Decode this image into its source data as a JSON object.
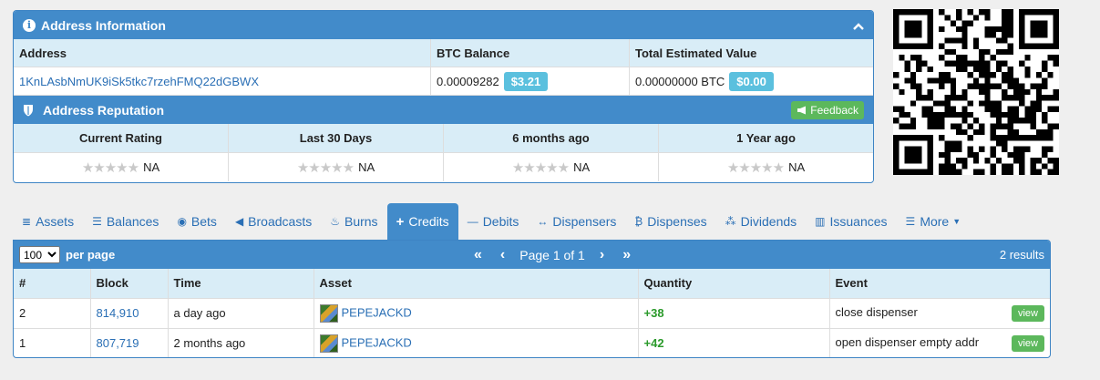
{
  "address_panel": {
    "title": "Address Information",
    "col_address": "Address",
    "col_balance": "BTC Balance",
    "col_total": "Total Estimated Value",
    "address": "1KnLAsbNmUK9iSk5tkc7rzehFMQ22dGBWX",
    "btc_balance": "0.00009282",
    "btc_balance_usd": "$3.21",
    "total_btc": "0.00000000 BTC",
    "total_usd": "$0.00"
  },
  "reputation": {
    "title": "Address Reputation",
    "feedback_label": "Feedback",
    "columns": [
      "Current Rating",
      "Last 30 Days",
      "6 months ago",
      "1 Year ago"
    ],
    "values": [
      "NA",
      "NA",
      "NA",
      "NA"
    ],
    "stars": "★★★★★"
  },
  "tabs": [
    {
      "label": "Assets",
      "icon": "≣"
    },
    {
      "label": "Balances",
      "icon": "☰"
    },
    {
      "label": "Bets",
      "icon": "◉"
    },
    {
      "label": "Broadcasts",
      "icon": "◀"
    },
    {
      "label": "Burns",
      "icon": "♨"
    },
    {
      "label": "Credits",
      "icon": "+"
    },
    {
      "label": "Debits",
      "icon": "—"
    },
    {
      "label": "Dispensers",
      "icon": "↔"
    },
    {
      "label": "Dispenses",
      "icon": "₿"
    },
    {
      "label": "Dividends",
      "icon": "⁂"
    },
    {
      "label": "Issuances",
      "icon": "▥"
    },
    {
      "label": "More",
      "icon": "☰"
    }
  ],
  "pager": {
    "per_page_value": "100",
    "per_page_label": "per page",
    "page_text": "Page 1 of 1",
    "results": "2 results"
  },
  "table": {
    "headers": [
      "#",
      "Block",
      "Time",
      "Asset",
      "Quantity",
      "Event"
    ],
    "rows": [
      {
        "num": "2",
        "block": "814,910",
        "time": "a day ago",
        "asset": "PEPEJACKD",
        "quantity": "+38",
        "event": "close dispenser",
        "action": "view"
      },
      {
        "num": "1",
        "block": "807,719",
        "time": "2 months ago",
        "asset": "PEPEJACKD",
        "quantity": "+42",
        "event": "open dispenser empty addr",
        "action": "view"
      }
    ]
  },
  "colors": {
    "primary": "#428bca",
    "header_bg": "#d9edf7",
    "success": "#5cb85c",
    "info": "#5bc0de",
    "link": "#2a6fb5"
  }
}
